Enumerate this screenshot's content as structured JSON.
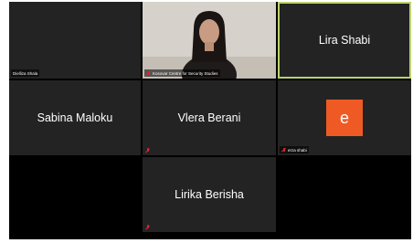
{
  "participants": [
    {
      "name": "Dielliza Shala"
    },
    {
      "name": "Kosovar Centre for Security Studies"
    },
    {
      "name": "Lira Shabi"
    },
    {
      "name": "Sabina Maloku"
    },
    {
      "name": "Vlera Berani"
    },
    {
      "name": "erza shabi",
      "avatar_letter": "e"
    },
    {
      "name": "Lirika Berisha"
    }
  ],
  "colors": {
    "active_speaker_border": "#b9d36e",
    "avatar_bg": "#ef5a24",
    "mic_off": "#e0242f",
    "tile_bg": "#232323"
  }
}
